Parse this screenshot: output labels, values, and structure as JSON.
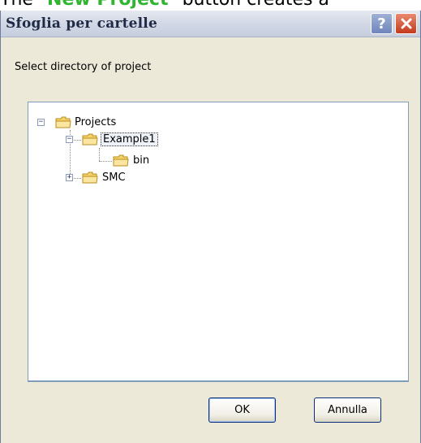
{
  "document": {
    "prefix": "The \"",
    "highlight": "New Project",
    "suffix": "\" button creates a"
  },
  "dialog": {
    "title": "Sfoglia per cartelle",
    "help_button": "?",
    "close_button": "✕",
    "prompt": "Select directory of project",
    "tree": [
      {
        "label": "Projects",
        "expanded": true,
        "expander": "−"
      },
      {
        "label": "Example1",
        "expanded": true,
        "expander": "−",
        "selected": true
      },
      {
        "label": "bin"
      },
      {
        "label": "SMC",
        "expanded": false,
        "expander": "+"
      }
    ],
    "ok_label": "OK",
    "cancel_label": "Annulla"
  },
  "colors": {
    "folder": "#f5d36a",
    "highlight_text": "#2fb52f",
    "close_button": "#c43a1c"
  }
}
